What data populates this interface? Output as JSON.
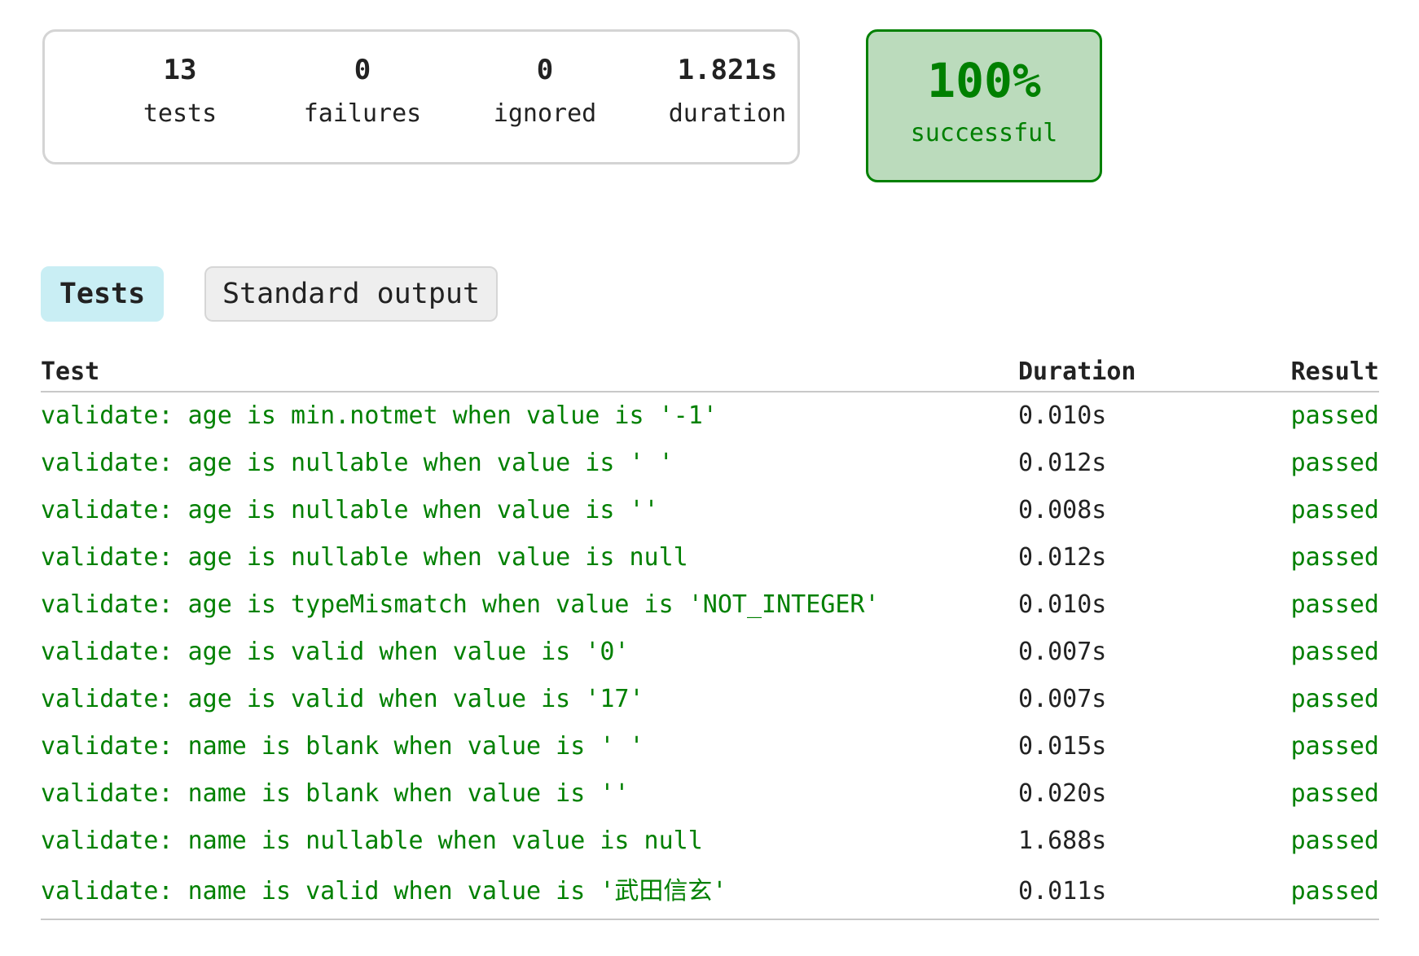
{
  "summary": {
    "tests": {
      "value": "13",
      "label": "tests"
    },
    "failures": {
      "value": "0",
      "label": "failures"
    },
    "ignored": {
      "value": "0",
      "label": "ignored"
    },
    "duration": {
      "value": "1.821s",
      "label": "duration"
    }
  },
  "success": {
    "percent": "100%",
    "label": "successful",
    "color": "#008000",
    "background": "#bbdbbc"
  },
  "tabs": {
    "tests": "Tests",
    "stdout": "Standard output"
  },
  "table": {
    "headers": {
      "test": "Test",
      "duration": "Duration",
      "result": "Result"
    },
    "rows": [
      {
        "name": "validate: age is min.notmet when value is '-1'",
        "duration": "0.010s",
        "result": "passed"
      },
      {
        "name": "validate: age is nullable when value is ' '",
        "duration": "0.012s",
        "result": "passed"
      },
      {
        "name": "validate: age is nullable when value is ''",
        "duration": "0.008s",
        "result": "passed"
      },
      {
        "name": "validate: age is nullable when value is null",
        "duration": "0.012s",
        "result": "passed"
      },
      {
        "name": "validate: age is typeMismatch when value is 'NOT_INTEGER'",
        "duration": "0.010s",
        "result": "passed"
      },
      {
        "name": "validate: age is valid when value is '0'",
        "duration": "0.007s",
        "result": "passed"
      },
      {
        "name": "validate: age is valid when value is '17'",
        "duration": "0.007s",
        "result": "passed"
      },
      {
        "name": "validate: name is blank when value is ' '",
        "duration": "0.015s",
        "result": "passed"
      },
      {
        "name": "validate: name is blank when value is ''",
        "duration": "0.020s",
        "result": "passed"
      },
      {
        "name": "validate: name is nullable when value is null",
        "duration": "1.688s",
        "result": "passed"
      },
      {
        "name": "validate: name is valid when value is '武田信玄'",
        "duration": "0.011s",
        "result": "passed"
      }
    ]
  }
}
